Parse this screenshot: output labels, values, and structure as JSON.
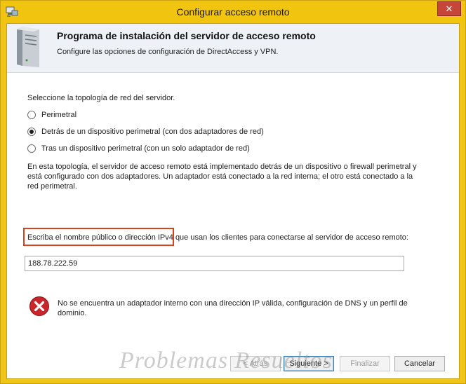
{
  "window": {
    "title": "Configurar acceso remoto",
    "close_label": "✕"
  },
  "header": {
    "title": "Programa de instalación del servidor de acceso remoto",
    "subtitle": "Configure las opciones de configuración de DirectAccess y VPN."
  },
  "topology": {
    "prompt": "Seleccione la topología de red del servidor.",
    "options": [
      {
        "label": "Perimetral",
        "selected": false
      },
      {
        "label": "Detrás de un dispositivo perimetral (con dos adaptadores de red)",
        "selected": true
      },
      {
        "label": "Tras un dispositivo perimetral (con un solo adaptador de red)",
        "selected": false
      }
    ],
    "description": "En esta topología, el servidor de acceso remoto está implementado detrás de un dispositivo o firewall perimetral y está configurado con dos adaptadores. Un adaptador está conectado a la red interna; el otro está conectado a la red perimetral."
  },
  "public_name": {
    "label": "Escriba el nombre público o dirección IPv4 que usan los clientes para conectarse al servidor de acceso remoto:",
    "value": "188.78.222.59"
  },
  "error": {
    "icon": "error-x-icon",
    "message": "No se encuentra un adaptador interno con una dirección IP válida, configuración de DNS y un perfil de dominio."
  },
  "buttons": {
    "back": "< Atrás",
    "next": "Siguiente >",
    "finish": "Finalizar",
    "cancel": "Cancelar"
  },
  "watermark": "Problemas Resueltos",
  "colors": {
    "frame": "#f1c40f",
    "close": "#c7463a",
    "highlight": "#d9411d",
    "error": "#c8262b"
  }
}
